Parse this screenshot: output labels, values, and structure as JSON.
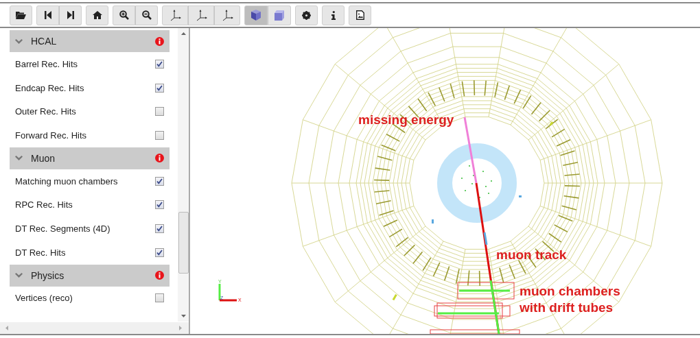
{
  "toolbar": {
    "groups": [
      [
        {
          "pressed": false
        }
      ],
      [
        {
          "pressed": false
        },
        {
          "pressed": false
        }
      ],
      [
        {
          "pressed": false
        }
      ],
      [
        {
          "pressed": false
        },
        {
          "pressed": false
        }
      ],
      [
        {
          "pressed": false
        },
        {
          "pressed": false
        },
        {
          "pressed": false
        }
      ],
      [
        {
          "pressed": true
        },
        {
          "pressed": false
        }
      ],
      [
        {
          "pressed": false
        }
      ],
      [
        {
          "pressed": false
        }
      ],
      [
        {
          "pressed": false
        }
      ]
    ]
  },
  "sidebar": {
    "sections": [
      {
        "title": "HCAL",
        "items": [
          {
            "label": "Barrel Rec. Hits",
            "checked": true
          },
          {
            "label": "Endcap Rec. Hits",
            "checked": true
          },
          {
            "label": "Outer Rec. Hits",
            "checked": false
          },
          {
            "label": "Forward Rec. Hits",
            "checked": false
          }
        ]
      },
      {
        "title": "Muon",
        "items": [
          {
            "label": "Matching muon chambers",
            "checked": true
          },
          {
            "label": "RPC Rec. Hits",
            "checked": true
          },
          {
            "label": "DT Rec. Segments (4D)",
            "checked": true
          },
          {
            "label": "DT Rec. Hits",
            "checked": true
          }
        ]
      },
      {
        "title": "Physics",
        "items": [
          {
            "label": "Vertices (reco)",
            "checked": false
          }
        ]
      }
    ]
  },
  "canvas": {
    "annotations": [
      "missing energy",
      "muon track",
      "muon chambers",
      "with drift tubes"
    ],
    "axis_labels": {
      "y": "Y",
      "z": "Z",
      "x": "X"
    }
  }
}
